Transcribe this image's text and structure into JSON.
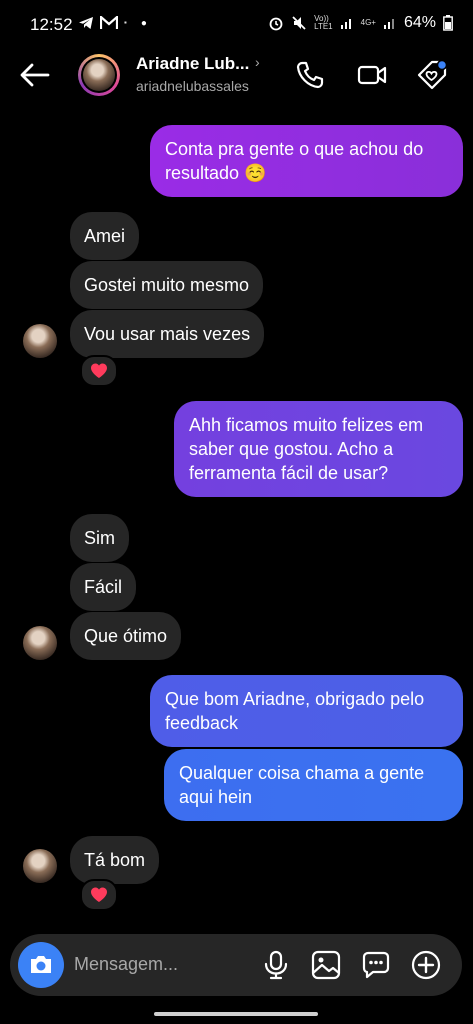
{
  "status": {
    "time": "12:52",
    "volte": "Vo))",
    "network_type": "LTE1",
    "network_4g": "4G+",
    "battery": "64%"
  },
  "header": {
    "name": "Ariadne Lub...",
    "username": "ariadnelubassales",
    "chevron": "›"
  },
  "messages": [
    {
      "from": "me",
      "text": "Conta pra gente o que achou do resultado ☺️"
    },
    {
      "from": "them",
      "text": "Amei"
    },
    {
      "from": "them",
      "text": "Gostei muito mesmo"
    },
    {
      "from": "them",
      "text": "Vou usar mais vezes",
      "reaction": "heart"
    },
    {
      "from": "me",
      "text": "Ahh ficamos muito felizes em saber que gostou. Acho a ferramenta fácil de usar?"
    },
    {
      "from": "them",
      "text": "Sim"
    },
    {
      "from": "them",
      "text": "Fácil"
    },
    {
      "from": "them",
      "text": "Que ótimo"
    },
    {
      "from": "me",
      "text": "Que bom Ariadne, obrigado pelo feedback"
    },
    {
      "from": "me",
      "text": "Qualquer coisa chama a gente aqui hein"
    },
    {
      "from": "them",
      "text": "Tá bom",
      "reaction": "heart"
    }
  ],
  "composer": {
    "placeholder": "Mensagem..."
  },
  "colors": {
    "background": "#000000",
    "incoming_bubble": "#262626",
    "outgoing_purple": "#8e2de2",
    "outgoing_blue": "#3b6ff0",
    "camera_button": "#3b82f6",
    "heart": "#ff3b5c"
  },
  "icons": [
    "back-arrow-icon",
    "phone-icon",
    "video-icon",
    "tag-icon",
    "camera-icon",
    "mic-icon",
    "gallery-icon",
    "sticker-icon",
    "plus-icon"
  ]
}
